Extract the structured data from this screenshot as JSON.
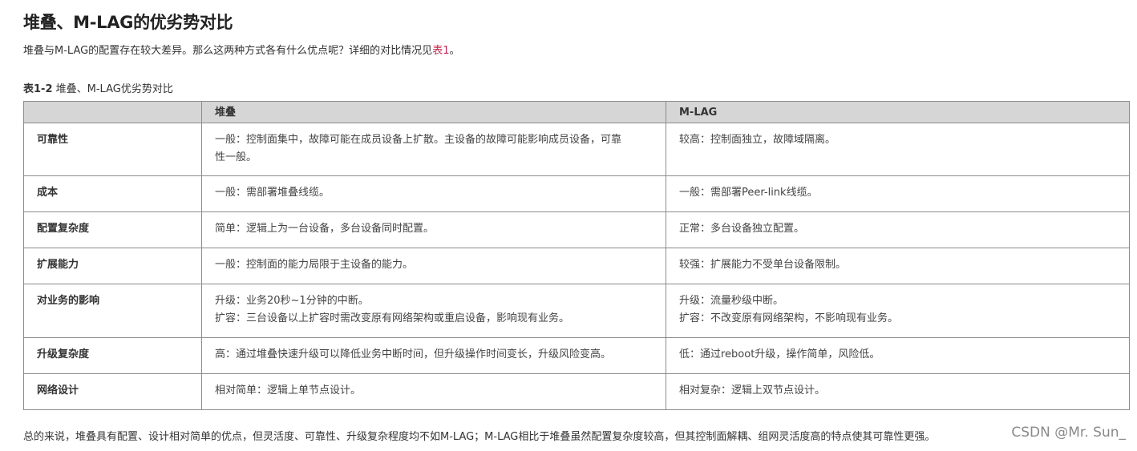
{
  "title": "堆叠、M-LAG的优劣势对比",
  "intro": {
    "text": "堆叠与M-LAG的配置存在较大差异。那么这两种方式各有什么优点呢？详细的对比情况见",
    "link": "表1",
    "end": "。"
  },
  "caption": {
    "label": "表1-2",
    "text": " 堆叠、M-LAG优劣势对比"
  },
  "table": {
    "headers": [
      "",
      "堆叠",
      "M-LAG"
    ],
    "rows": [
      {
        "aspect": "可靠性",
        "stack": [
          "一般：控制面集中，故障可能在成员设备上扩散。主设备的故障可能影响成员设备，可靠",
          "性一般。"
        ],
        "mlag": [
          "较高：控制面独立，故障域隔离。"
        ]
      },
      {
        "aspect": "成本",
        "stack": [
          "一般：需部署堆叠线缆。"
        ],
        "mlag": [
          "一般：需部署Peer-link线缆。"
        ]
      },
      {
        "aspect": "配置复杂度",
        "stack": [
          "简单：逻辑上为一台设备，多台设备同时配置。"
        ],
        "mlag": [
          "正常：多台设备独立配置。"
        ]
      },
      {
        "aspect": "扩展能力",
        "stack": [
          "一般：控制面的能力局限于主设备的能力。"
        ],
        "mlag": [
          "较强：扩展能力不受单台设备限制。"
        ]
      },
      {
        "aspect": "对业务的影响",
        "stack": [
          "升级：业务20秒~1分钟的中断。",
          "扩容：三台设备以上扩容时需改变原有网络架构或重启设备，影响现有业务。"
        ],
        "mlag": [
          "升级：流量秒级中断。",
          "扩容：不改变原有网络架构，不影响现有业务。"
        ]
      },
      {
        "aspect": "升级复杂度",
        "stack": [
          "高：通过堆叠快速升级可以降低业务中断时间，但升级操作时间变长，升级风险变高。"
        ],
        "mlag": [
          "低：通过reboot升级，操作简单，风险低。"
        ]
      },
      {
        "aspect": "网络设计",
        "stack": [
          "相对简单：逻辑上单节点设计。"
        ],
        "mlag": [
          "相对复杂：逻辑上双节点设计。"
        ]
      }
    ]
  },
  "summary": "总的来说，堆叠具有配置、设计相对简单的优点，但灵活度、可靠性、升级复杂程度均不如M-LAG；M-LAG相比于堆叠虽然配置复杂度较高，但其控制面解耦、组网灵活度高的特点使其可靠性更强。",
  "watermark": "CSDN @Mr. Sun_"
}
